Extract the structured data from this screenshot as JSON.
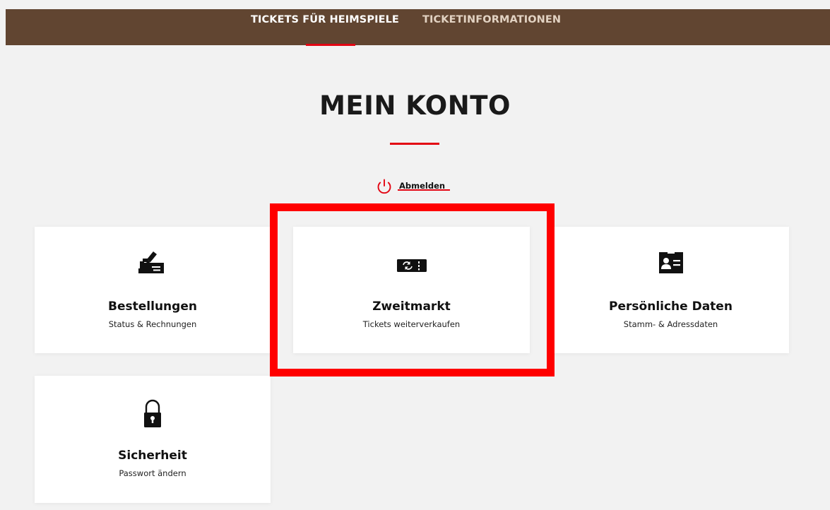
{
  "nav": {
    "tabs": [
      {
        "label": "TICKETS FÜR HEIMSPIELE",
        "active": true
      },
      {
        "label": "TICKETINFORMATIONEN",
        "active": false
      }
    ]
  },
  "page": {
    "title": "MEIN KONTO"
  },
  "logout": {
    "label": "Abmelden",
    "icon": "power-icon"
  },
  "cards": [
    {
      "title": "Bestellungen",
      "subtitle": "Status & Rechnungen",
      "icon": "order-sign-icon"
    },
    {
      "title": "Zweitmarkt",
      "subtitle": "Tickets weiterverkaufen",
      "icon": "ticket-resale-icon"
    },
    {
      "title": "Persönliche Daten",
      "subtitle": "Stamm- & Adressdaten",
      "icon": "id-card-icon"
    },
    {
      "title": "Sicherheit",
      "subtitle": "Passwort ändern",
      "icon": "lock-icon"
    }
  ],
  "colors": {
    "header_bg": "#614531",
    "accent": "#e30613",
    "highlight": "#ff0000",
    "page_bg": "#f2f2f2"
  }
}
